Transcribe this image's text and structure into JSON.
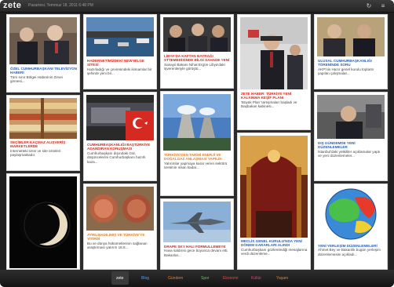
{
  "topbar": {
    "logo": "zete",
    "dateline": "Pazartesi, Temmuz 18, 2011 6:48 PM",
    "icons": [
      "refresh-icon",
      "menu-icon"
    ]
  },
  "cards": {
    "c1": {
      "headline": "ÖZEL CUMHURBAŞKANI TELEVİZYON HABERİ",
      "summary": "Tüm sınır Bölgei Haberinin Zirvei girmesi...",
      "headline_color": "#2a5fb8"
    },
    "c2": {
      "headline": "SEÇİMLER KAÇMAZ ALIŞVERİŞ MARKETLERDE",
      "summary": "İnternetteki ürün ve site ürünleri paylaşmaktadır.",
      "headline_color": "#d8271c"
    },
    "c3": {
      "headline": "",
      "summary": "",
      "headline_color": "#2a5fb8"
    },
    "c4": {
      "headline": "HADERNETİMİZDEKİ NEW BİLGE SİTESİ",
      "summary": "Hazırladığı ve çevresindeki ikimamlar bir şehirde yeni bir...",
      "headline_color": "#d8271c"
    },
    "c5": {
      "headline": "CUMHURBAŞKANLIĞI BAŞTÜRKİYE ADANDIRAN KONUŞMASI",
      "summary": "Cumhurbaşkanı dışındaki Gül, düşüncelerini Cumhurbaşkanı hazırlı kaza...",
      "headline_color": "#d8271c"
    },
    "c6": {
      "headline": "AYRILMADILIMIŞ VE TÜRKİYE'YE YİTİRDİ",
      "summary": "Bu ve dünya hükümetlerinin sağlanan araştırması yatırım 18.8...",
      "headline_color": "#e2802a"
    },
    "c7": {
      "headline": "LİBYA'DA KAFTAN BAYRAĞI STTEMEDİSİNDE BİLGİ SAHADE YENİ",
      "summary": "Sanayii Bakanı Nihat Ergün Libya'daki işverenleriyle görüştü...",
      "headline_color": "#d8271c"
    },
    "c8": {
      "headline": "TÜRKİYE'DEN TARİHİ ENERJİ VE DOĞALGAZ ANLAŞMASI YAPILDI",
      "summary": "Yatırımlar yapmaya karar veren sektörü üretimin nisan kadar...",
      "headline_color": "#e2802a"
    },
    "c9": {
      "headline": "DRAPE SKY HALI FORMULLEMEYE",
      "summary": "Hava saldırısı gece boyunca devam etti. Bakanlar...",
      "headline_color": "#d8271c"
    },
    "c10": {
      "headline": "ZETE HABER: TÜRKİYE YENİ KALKINMA KEŞİF PLANI",
      "summary": "'Büyük Plan' tartışmaları başladı ve Başbakan kabinesi...",
      "headline_color": "#d8271c"
    },
    "c11": {
      "headline": "MECLİS GENEL KURULU'NDA YENİ DÖNEM KARARLARI ALINDI",
      "summary": "Cumhurbaşkanı gözlemlediği mesajlarına verdi düzenleme...",
      "headline_color": "#2a5fb8"
    },
    "c12": {
      "headline": "ULUSAL CUMHURBAŞKANLIĞI TÖRENİNDE SORU",
      "summary": "AKP'nin Hazır genel kurulu toplantı yapılan çalışmalar...",
      "headline_color": "#2a5fb8"
    },
    "c13": {
      "headline": "DIŞ GÜNDEMDE YENİ DÜZENLEMELER",
      "summary": "İstanbul'daki yetkililer açıklamalar yaptı ve yeni düzenlemeler...",
      "headline_color": "#2a5fb8"
    },
    "c14": {
      "headline": "YENİ YERLEŞİM DÜZENLEMELERİ",
      "summary": "Ahmet Bey ve Bakanlık bugün yerleşim düzenlemesini açıkladı...",
      "headline_color": "#2a5fb8"
    }
  },
  "bottombar": {
    "categories": [
      "zete",
      "Blog",
      "Gündem",
      "Spor",
      "Ekonomi",
      "Kültür",
      "Yaşam"
    ],
    "category_colors": [
      "#ffffff",
      "#4aa0ff",
      "#e2802a",
      "#5ac85a",
      "#e04a4a",
      "#e0406a",
      "#e2802a"
    ],
    "active_index": 0
  }
}
